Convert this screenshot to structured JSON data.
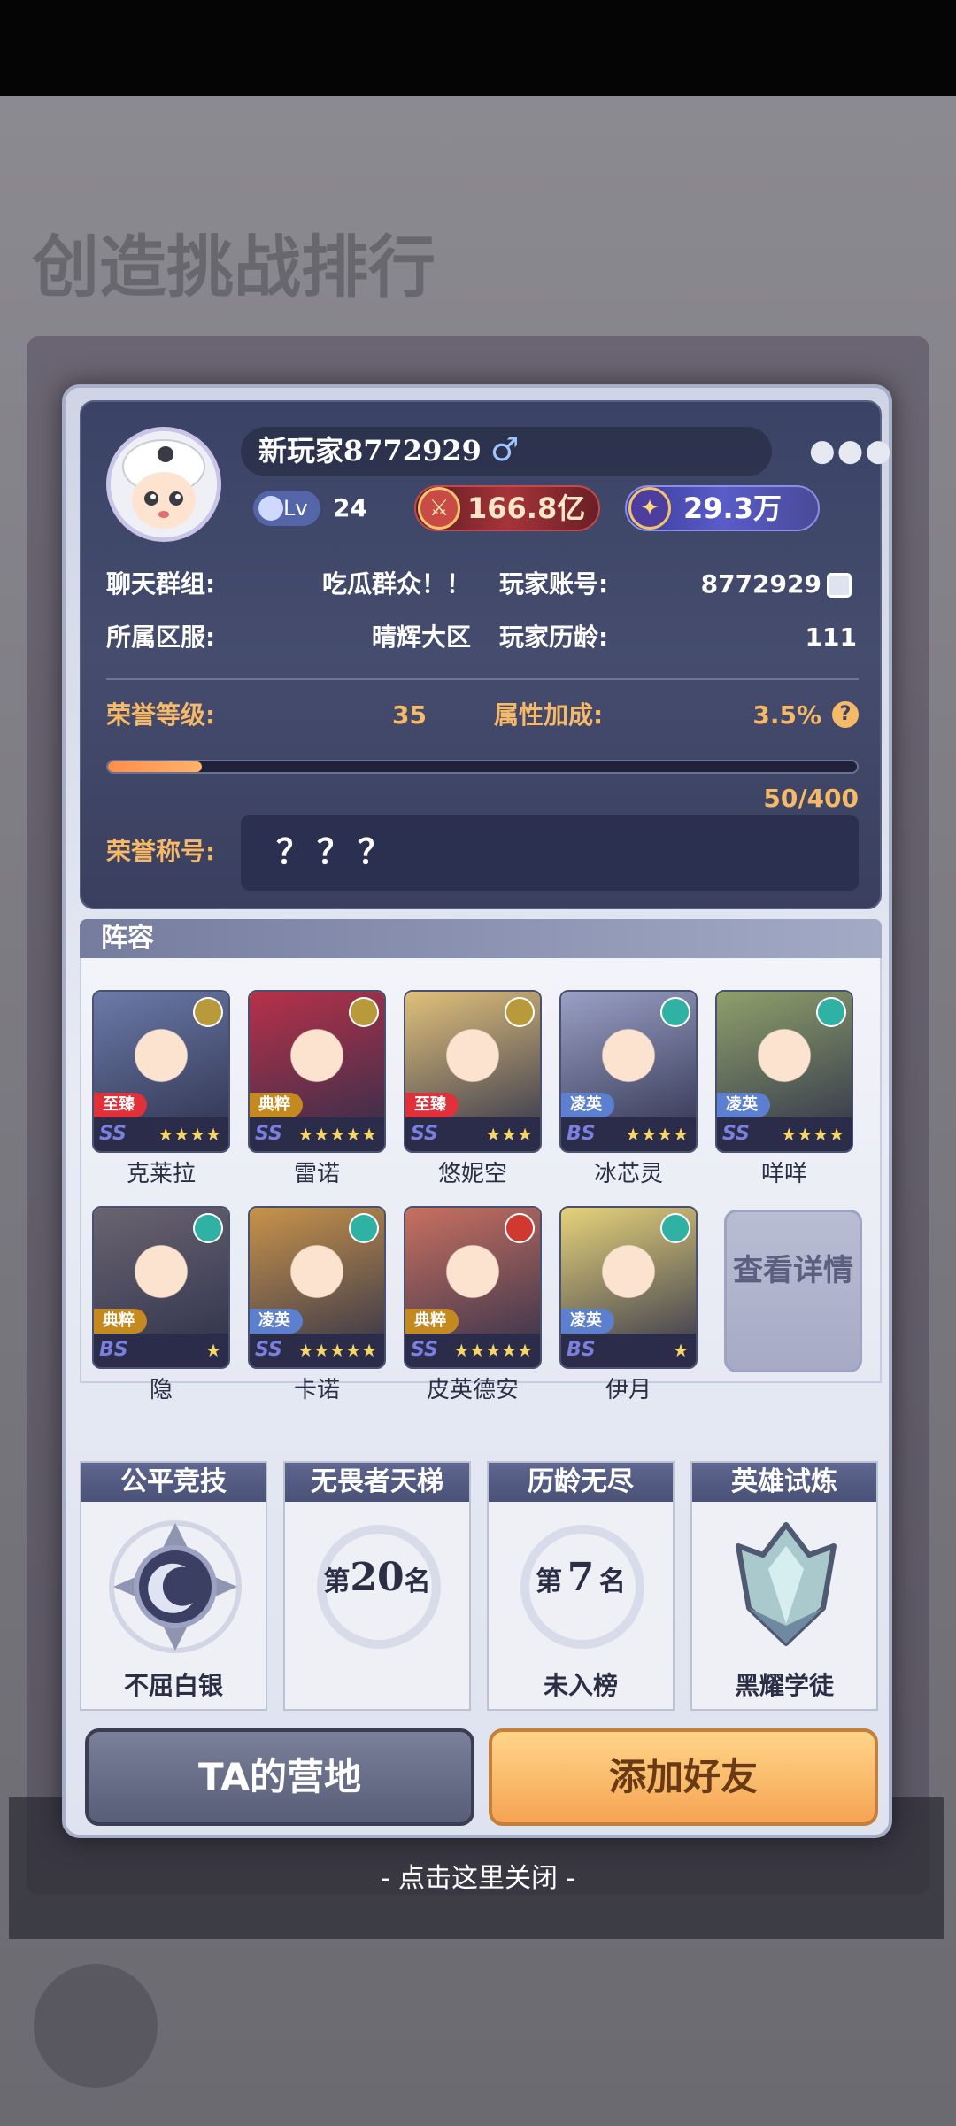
{
  "player": {
    "name": "新玩家8772929",
    "gender_symbol": "♂",
    "more_symbol": "●●●",
    "level_label": "Lv",
    "level": "24",
    "power": "166.8亿",
    "crystal": "29.3万"
  },
  "info": {
    "chat_group_label": "聊天群组:",
    "chat_group_value": "吃瓜群众！！",
    "account_label": "玩家账号:",
    "account_value": "8772929",
    "server_label": "所属区服:",
    "server_value": "晴辉大区",
    "age_label": "玩家历龄:",
    "age_value": "111"
  },
  "honor": {
    "level_label": "荣誉等级:",
    "level_value": "35",
    "bonus_label": "属性加成:",
    "bonus_value": "3.5%",
    "help_symbol": "?",
    "progress_text": "50/400",
    "progress_fraction": 0.125,
    "title_label": "荣誉称号:",
    "title_value": "？？？"
  },
  "lineup": {
    "title": "阵容",
    "details_button": "查看详情",
    "heroes": [
      {
        "name": "克莱拉",
        "tag": "至臻",
        "grade": "SS",
        "stars": "★★★★",
        "tag_color": "#e0303a",
        "art_color": "#6b7aa8",
        "emblem_color": "#b89a3c"
      },
      {
        "name": "雷诺",
        "tag": "典粹",
        "grade": "SS",
        "stars": "★★★★★",
        "tag_color": "#c58a1f",
        "art_color": "#b8304a",
        "emblem_color": "#b89a3c"
      },
      {
        "name": "悠妮空",
        "tag": "至臻",
        "grade": "SS",
        "stars": "★★★",
        "tag_color": "#e0303a",
        "art_color": "#e0c07a",
        "emblem_color": "#b89a3c"
      },
      {
        "name": "冰芯灵",
        "tag": "凌英",
        "grade": "BS",
        "stars": "★★★★",
        "tag_color": "#5d7fd0",
        "art_color": "#9aa0c6",
        "emblem_color": "#2fb1a4"
      },
      {
        "name": "咩咩",
        "tag": "凌英",
        "grade": "SS",
        "stars": "★★★★",
        "tag_color": "#5d7fd0",
        "art_color": "#8fa06a",
        "emblem_color": "#2fb1a4"
      },
      {
        "name": "隐",
        "tag": "典粹",
        "grade": "BS",
        "stars": "★",
        "tag_color": "#c58a1f",
        "art_color": "#6a6470",
        "emblem_color": "#2fb1a4"
      },
      {
        "name": "卡诺",
        "tag": "凌英",
        "grade": "SS",
        "stars": "★★★★★",
        "tag_color": "#5d7fd0",
        "art_color": "#c8934a",
        "emblem_color": "#2fb1a4"
      },
      {
        "name": "皮英德安",
        "tag": "典粹",
        "grade": "SS",
        "stars": "★★★★★",
        "tag_color": "#c58a1f",
        "art_color": "#c87060",
        "emblem_color": "#d0392f"
      },
      {
        "name": "伊月",
        "tag": "凌英",
        "grade": "BS",
        "stars": "★",
        "tag_color": "#5d7fd0",
        "art_color": "#e6d27a",
        "emblem_color": "#2fb1a4"
      }
    ]
  },
  "ranks": [
    {
      "title": "公平竞技",
      "footer": "不屈白银"
    },
    {
      "title": "无畏者天梯",
      "rank_pre": "第",
      "rank_num": "20",
      "rank_post": "名",
      "footer": ""
    },
    {
      "title": "历龄无尽",
      "rank_pre": "第",
      "rank_num": "7",
      "rank_post": "名",
      "footer": "未入榜"
    },
    {
      "title": "英雄试炼",
      "footer": "黑耀学徒"
    }
  ],
  "buttons": {
    "camp": "TA的营地",
    "add_friend": "添加好友"
  },
  "background": {
    "title": "创造挑战排行"
  },
  "close_hint": "- 点击这里关闭 -"
}
